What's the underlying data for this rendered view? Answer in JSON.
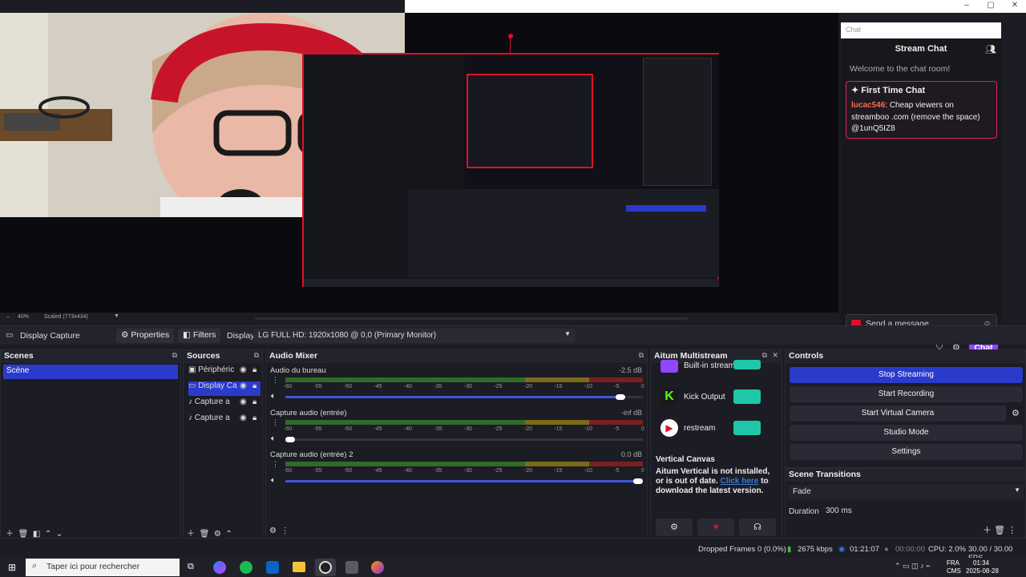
{
  "window": {
    "min": "–",
    "max": "▢",
    "close": "✕"
  },
  "chat": {
    "search_placeholder": "Chat",
    "title": "Stream Chat",
    "welcome": "Welcome to the chat room!",
    "first_time_title": "First Time Chat",
    "first_user": "lucac546",
    "first_msg": ": Cheap viewers on streamboo .com (remove the space) @1unQ5IZ8",
    "send_placeholder": "Send a message",
    "chat_button": "Chat"
  },
  "preview": {
    "zoom": "40%",
    "scaled": "Scaled (773x434)"
  },
  "source_toolbar": {
    "source": "Display Capture",
    "properties": "Properties",
    "filters": "Filters",
    "display_label": "Display",
    "display_value": "LG FULL HD: 1920x1080 @ 0,0 (Primary Monitor)"
  },
  "scenes": {
    "title": "Scenes",
    "items": [
      "Scène"
    ]
  },
  "sources": {
    "title": "Sources",
    "items": [
      "Périphéric",
      "Display Ca",
      "Capture a",
      "Capture a"
    ]
  },
  "mixer": {
    "title": "Audio Mixer",
    "ticks": [
      "0",
      "-5",
      "-10",
      "-15",
      "-20",
      "-25",
      "-30",
      "-35",
      "-40",
      "-45",
      "-50",
      "-55",
      "-60"
    ],
    "channels": [
      {
        "name": "Audio du bureau",
        "db": "-2.5 dB",
        "level": 0.95
      },
      {
        "name": "Capture audio (entrée)",
        "db": "-inf dB",
        "level": 0.0
      },
      {
        "name": "Capture audio (entrée) 2",
        "db": "0.0 dB",
        "level": 1.0
      }
    ]
  },
  "multistream": {
    "title": "Aitum Multistream",
    "outputs": [
      "Built-in stream",
      "Kick Output",
      "restream"
    ],
    "vertical_title": "Vertical Canvas",
    "vertical_text": "Aitum Vertical is not installed, or is out of date.",
    "link": "Click here",
    "link_rest": " to download the latest version."
  },
  "controls": {
    "title": "Controls",
    "stop_streaming": "Stop Streaming",
    "start_recording": "Start Recording",
    "start_virtual_camera": "Start Virtual Camera",
    "studio_mode": "Studio Mode",
    "settings": "Settings"
  },
  "transitions": {
    "title": "Scene Transitions",
    "value": "Fade",
    "duration_label": "Duration",
    "duration_value": "300 ms"
  },
  "status": {
    "dropped": "Dropped Frames 0 (0.0%)",
    "bitrate": "2675 kbps",
    "stream_time": "01:21:07",
    "rec_time": "00:00:00",
    "cpu": "CPU: 2.0%",
    "fps": "30.00 / 30.00 FPS"
  },
  "taskbar": {
    "search": "Taper ici pour rechercher",
    "lang": "FRA",
    "lang2": "CMS",
    "time": "01:34",
    "date": "2025-08-28"
  },
  "colors": {
    "accent": "#2a3bcb",
    "live": "#e0102a",
    "twitch": "#9147ff",
    "toggle": "#1ec7a8"
  }
}
